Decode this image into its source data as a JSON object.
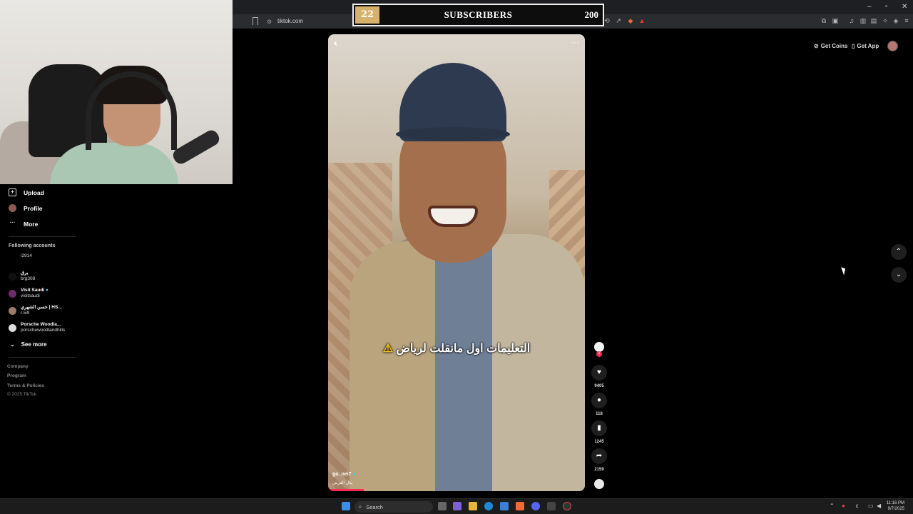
{
  "overlay": {
    "current": "22",
    "label": "SUBSCRIBERS",
    "goal": "200"
  },
  "browser": {
    "url": "tiktok.com"
  },
  "header": {
    "get_coins": "Get Coins",
    "get_app": "Get App"
  },
  "sidebar": {
    "nav": [
      {
        "label": "Upload",
        "icon": "upload-icon"
      },
      {
        "label": "Profile",
        "icon": "profile-avatar"
      },
      {
        "label": "More",
        "icon": "more-icon"
      }
    ],
    "following_title": "Following accounts",
    "accounts": [
      {
        "name": "",
        "handle": "i2914"
      },
      {
        "name": "برق",
        "handle": "brg308"
      },
      {
        "name": "Visit Saudi",
        "handle": "visitsaudi"
      },
      {
        "name": "حسن الشهري | HS...",
        "handle": "r.5i9"
      },
      {
        "name": "Porsche Woodla...",
        "handle": "porschewoodlandhills"
      }
    ],
    "see_more": "See more",
    "footer": [
      "Company",
      "Program",
      "Terms & Policies",
      "© 2025 TikTok"
    ]
  },
  "video": {
    "caption": "التعليمات اول مانقلت لرياض",
    "username": "go_nei7",
    "description": "يبال الفرص"
  },
  "actions": {
    "likes": "9405",
    "comments": "118",
    "saves": "1245",
    "shares": "2159"
  },
  "taskbar": {
    "search": "Search",
    "time": "11:16 PM",
    "date": "9/7/2025"
  }
}
